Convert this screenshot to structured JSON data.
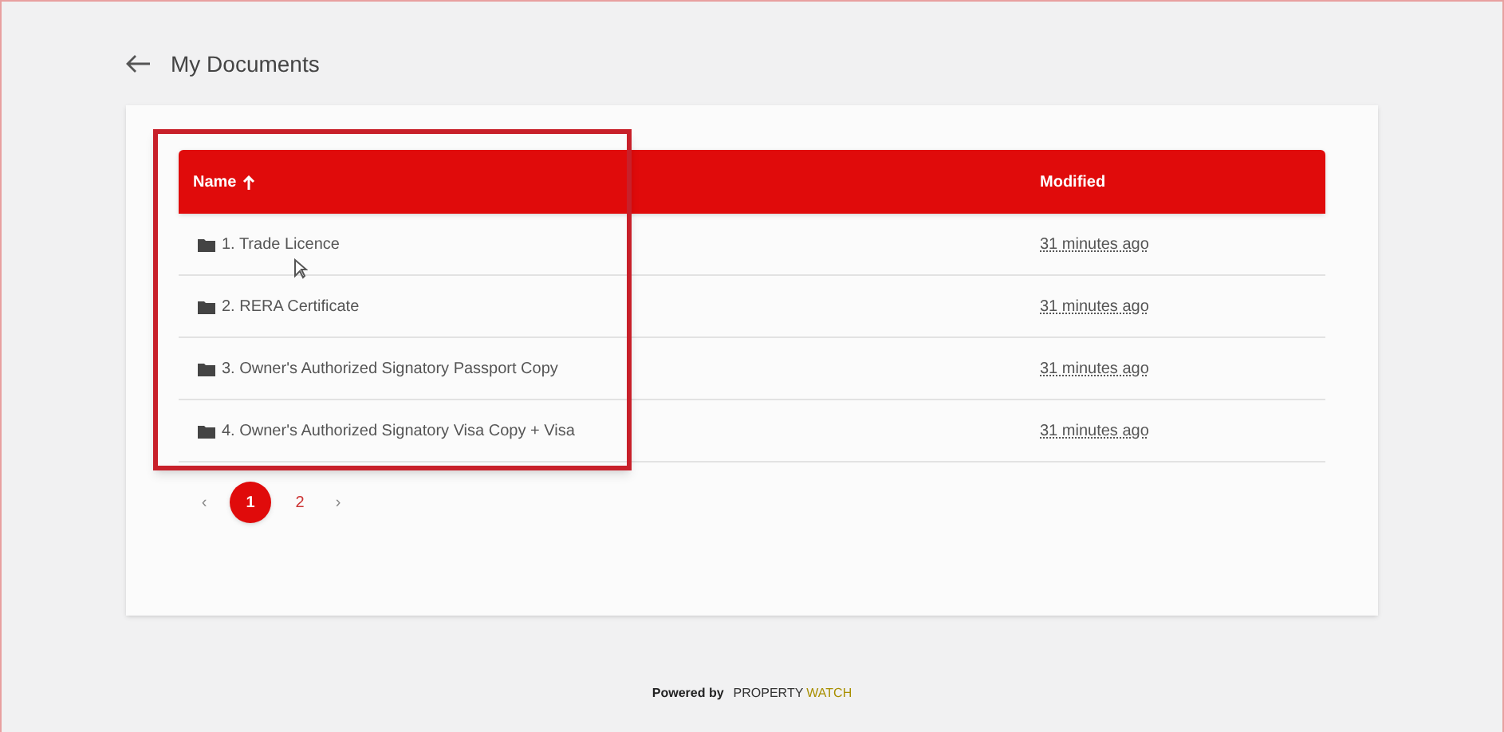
{
  "page_title": "My Documents",
  "table": {
    "columns": [
      {
        "label": "Name",
        "sorted_ascending": true
      },
      {
        "label": "Modified"
      }
    ],
    "rows": [
      {
        "name": "1. Trade Licence",
        "modified": "31 minutes ago"
      },
      {
        "name": "2. RERA Certificate",
        "modified": "31 minutes ago"
      },
      {
        "name": "3. Owner's Authorized Signatory Passport Copy",
        "modified": "31 minutes ago"
      },
      {
        "name": "4. Owner's Authorized Signatory Visa Copy + Visa",
        "modified": "31 minutes ago"
      }
    ]
  },
  "pagination": {
    "prev": "‹",
    "next": "›",
    "pages": [
      {
        "label": "1",
        "selected": true
      },
      {
        "label": "2",
        "selected": false
      }
    ]
  },
  "footer": {
    "prefix": "Powered by",
    "brand": "PROPERTY",
    "brand_accent": "WATCH"
  }
}
